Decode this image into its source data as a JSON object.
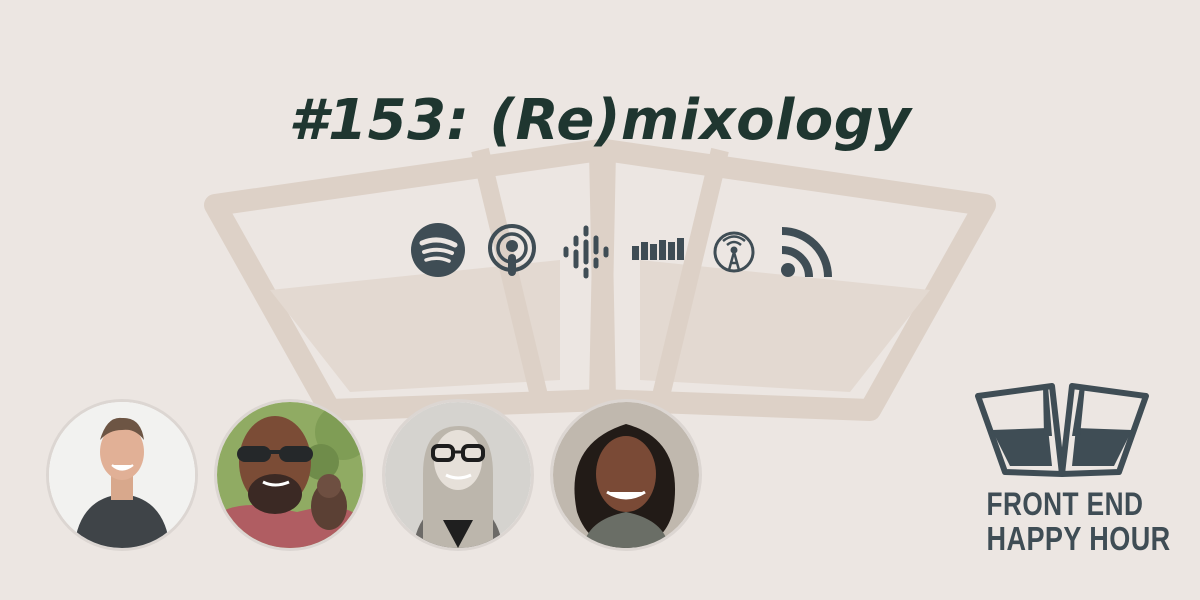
{
  "episode": {
    "title": "#153: (Re)mixology"
  },
  "platforms": [
    {
      "icon": "spotify-icon"
    },
    {
      "icon": "apple-podcasts-icon"
    },
    {
      "icon": "google-podcasts-icon"
    },
    {
      "icon": "castbox-icon"
    },
    {
      "icon": "overcast-icon"
    },
    {
      "icon": "rss-icon"
    }
  ],
  "brand": {
    "line1": "FRONT END",
    "line2": "HAPPY HOUR"
  },
  "colors": {
    "background": "#ece6e2",
    "title": "#1f3630",
    "icon": "#3f4d55",
    "watermark": "#ddd1c7"
  }
}
